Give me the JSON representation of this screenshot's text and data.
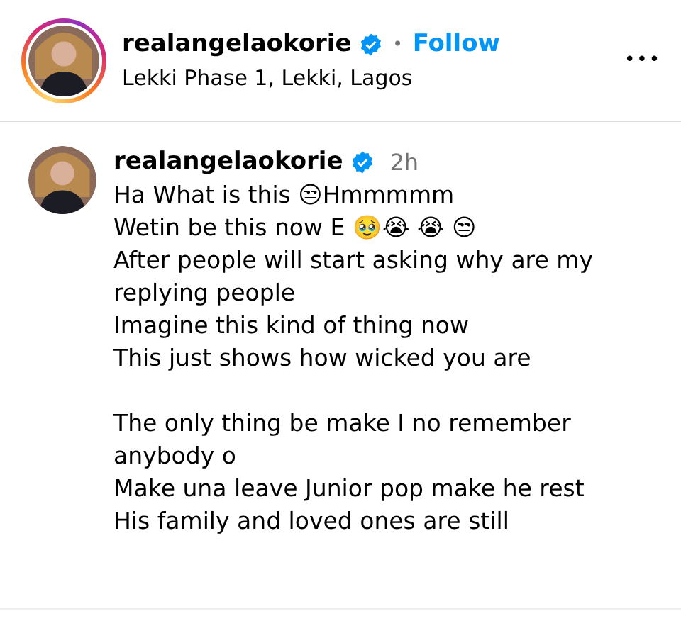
{
  "header": {
    "username": "realangelaokorie",
    "verified": true,
    "separator": "•",
    "follow": "Follow",
    "location": "Lekki Phase 1, Lekki, Lagos",
    "menu": "•••",
    "story_ring": true
  },
  "comment": {
    "username": "realangelaokorie",
    "verified": true,
    "time": "2h",
    "paragraphs": [
      [
        "Ha What is this 😒Hmmmmm",
        "Wetin be this now E 🥹😭 😭 😒",
        "After people will start asking why are my replying people",
        "Imagine this kind of thing now",
        "This just shows how wicked you are"
      ],
      [
        "The only thing be make I no remember anybody o",
        "Make una leave Junior pop make he rest",
        "His family and loved ones are still"
      ]
    ]
  }
}
